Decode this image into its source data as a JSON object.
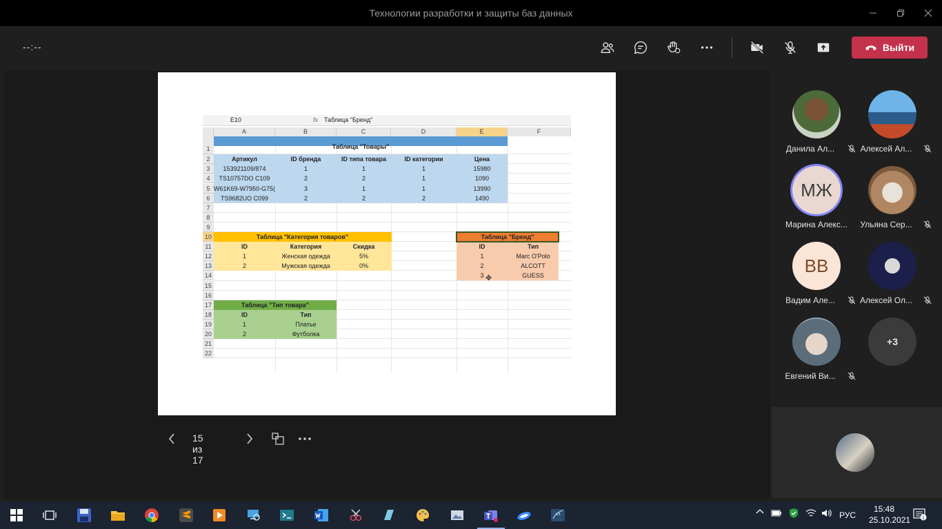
{
  "window": {
    "title": "Технологии разработки и защиты баз данных"
  },
  "toolbar": {
    "timer": "--:--",
    "leave_label": "Выйти",
    "icons": [
      "participants-icon",
      "chat-icon",
      "raise-hand-icon",
      "more-icon",
      "camera-off-icon",
      "mic-off-icon",
      "share-icon"
    ]
  },
  "excel": {
    "name_box": "E10",
    "formula": "Таблица \"Бренд\"",
    "columns": [
      "A",
      "B",
      "C",
      "D",
      "E",
      "F"
    ],
    "rows": [
      "1",
      "2",
      "3",
      "4",
      "5",
      "6",
      "7",
      "8",
      "9",
      "10",
      "11",
      "12",
      "13",
      "14",
      "15",
      "16",
      "17",
      "18",
      "19",
      "20",
      "21",
      "22"
    ],
    "products": {
      "title": "Таблица \"Товары\"",
      "headers": [
        "Артикул",
        "ID бренда",
        "ID типа товара",
        "ID категории",
        "Цена"
      ],
      "rows": [
        [
          "153921109/874",
          "1",
          "1",
          "1",
          "15980"
        ],
        [
          "TS10757DO C109",
          "2",
          "2",
          "1",
          "1090"
        ],
        "W61K69-W7950-G75(|3|1|1|13990",
        [
          "TS9682UO C099",
          "2",
          "2",
          "2",
          "1490"
        ]
      ]
    },
    "categories": {
      "title": "Таблица \"Категория товаров\"",
      "headers": [
        "ID",
        "Категория",
        "Скидка"
      ],
      "rows": [
        [
          "1",
          "Женская одежда",
          "5%"
        ],
        [
          "2",
          "Мужская одежда",
          "0%"
        ]
      ]
    },
    "brands": {
      "title": "Таблица \"Бренд\"",
      "headers": [
        "ID",
        "Тип"
      ],
      "rows": [
        [
          "1",
          "Marc O'Polo"
        ],
        [
          "2",
          "ALCOTT"
        ],
        [
          "3",
          "GUESS"
        ]
      ]
    },
    "types": {
      "title": "Таблица \"Тип товара\"",
      "headers": [
        "ID",
        "Тип"
      ],
      "rows": [
        [
          "1",
          "Платье"
        ],
        [
          "2",
          "Футболка"
        ]
      ]
    }
  },
  "slide_nav": {
    "counter": "15 из 17"
  },
  "participants": [
    {
      "name": "Данила Ал...",
      "initials": "",
      "muted": true
    },
    {
      "name": "Алексей Ал...",
      "initials": "",
      "muted": true
    },
    {
      "name": "Марина Алекс...",
      "initials": "МЖ",
      "muted": false
    },
    {
      "name": "Ульяна Сер...",
      "initials": "",
      "muted": true
    },
    {
      "name": "Вадим Але...",
      "initials": "ВВ",
      "muted": true
    },
    {
      "name": "Алексей Ол...",
      "initials": "",
      "muted": true
    },
    {
      "name": "Евгений Ви...",
      "initials": "",
      "muted": true
    }
  ],
  "overflow_count": "+3",
  "taskbar": {
    "lang": "РУС",
    "time": "15:48",
    "date": "25.10.2021",
    "notifications": "1"
  },
  "colors": {
    "leave": "#c4314b",
    "products_header": "#5b9bd5",
    "products_body": "#bdd7ee",
    "categories_header": "#ffc000",
    "categories_body": "#ffe699",
    "brands_header": "#ed7d31",
    "brands_body": "#f8cbad",
    "types_header": "#70ad47",
    "types_body": "#a9d08e"
  }
}
